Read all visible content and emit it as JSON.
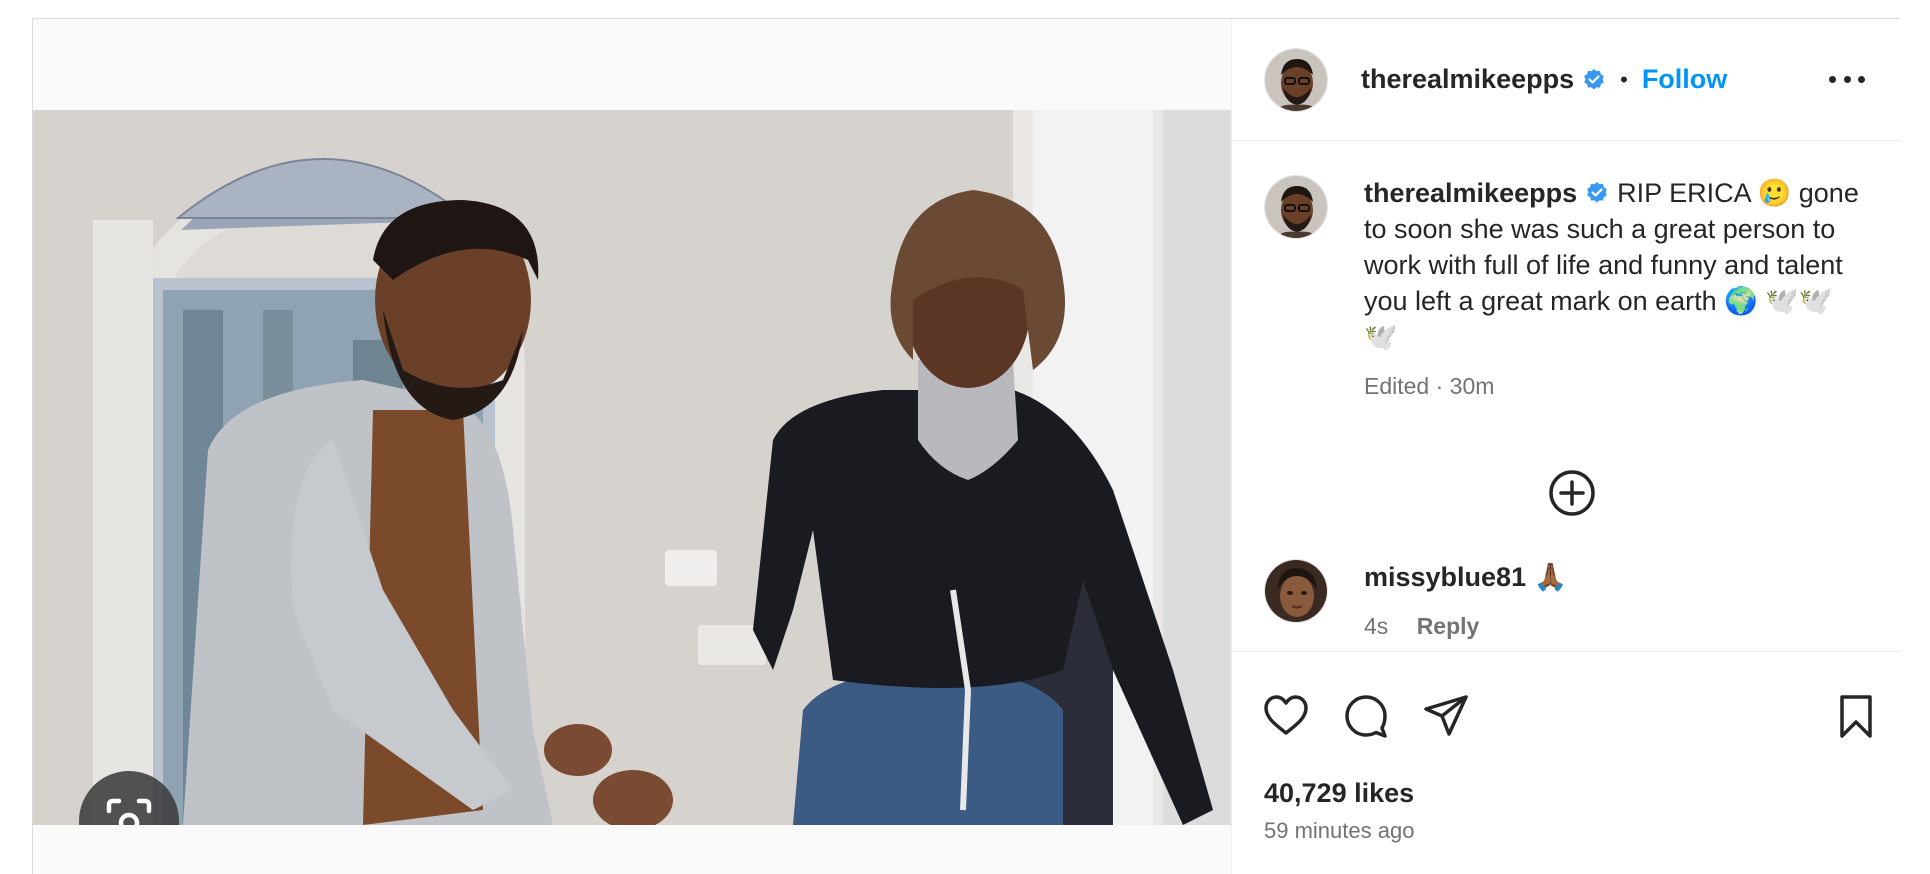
{
  "post": {
    "author": "therealmikeepps",
    "follow_label": "Follow",
    "separator": "•",
    "caption_text": "RIP ERICA 🥲 gone to soon she was such a great person to work with full of life and funny and talent you left a great mark on earth 🌍 🕊️🕊️🕊️",
    "caption_meta": "Edited · 30m",
    "likes": "40,729 likes",
    "time_ago": "59 minutes ago"
  },
  "comments": [
    {
      "username": "missyblue81",
      "emoji": "🙏🏾",
      "age": "4s",
      "reply_label": "Reply"
    }
  ],
  "icons": {
    "verified": "verified-badge-icon",
    "more": "more-options-icon",
    "add_comment": "add-circle-icon",
    "like": "heart-icon",
    "comment": "comment-bubble-icon",
    "share": "paper-plane-icon",
    "save": "bookmark-icon",
    "lens": "visual-search-icon"
  },
  "colors": {
    "accent": "#0095f6",
    "verified": "#3897f0",
    "text": "#262626",
    "muted": "#737373"
  }
}
